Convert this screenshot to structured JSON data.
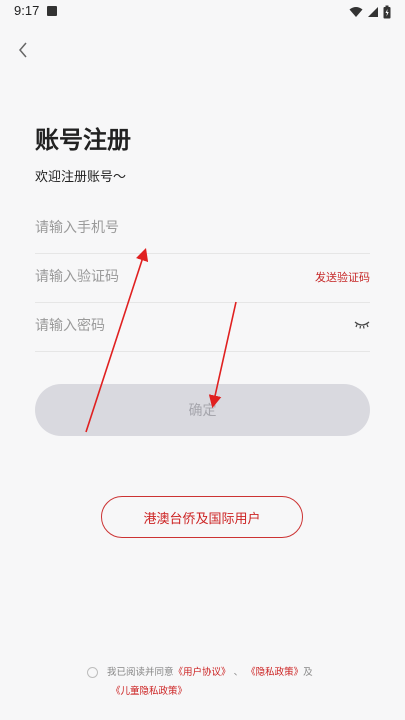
{
  "status_bar": {
    "time": "9:17",
    "icons": [
      "notification-a-icon",
      "wifi-icon",
      "signal-icon",
      "battery-charging-icon"
    ]
  },
  "header": {
    "back_icon": "chevron-left-icon"
  },
  "page": {
    "title": "账号注册",
    "subtitle": "欢迎注册账号～"
  },
  "form": {
    "phone_placeholder": "请输入手机号",
    "code_placeholder": "请输入验证码",
    "send_code_label": "发送验证码",
    "password_placeholder": "请输入密码",
    "password_toggle_icon": "eye-closed-icon",
    "confirm_label": "确定"
  },
  "intl_button_label": "港澳台侨及国际用户",
  "agreement": {
    "prefix": "我已阅读并同意",
    "user_agreement": "《用户协议》",
    "separator": "、",
    "privacy_policy": "《隐私政策》",
    "and": "及",
    "children_privacy": "《儿童隐私政策》"
  },
  "colors": {
    "accent": "#cc2222",
    "background": "#f7f7f8",
    "button_disabled": "#d9d9df",
    "annotation_arrow": "#e02020"
  }
}
